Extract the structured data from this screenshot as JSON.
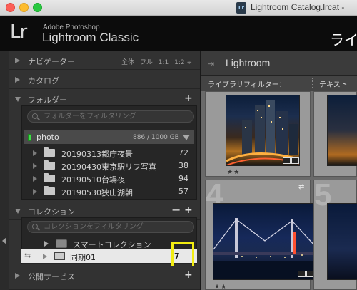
{
  "window": {
    "title": "Lightroom Catalog.lrcat - ",
    "doc_icon_text": "Lr"
  },
  "identity": {
    "logo": "Lr",
    "line1": "Adobe Photoshop",
    "line2": "Lightroom Classic",
    "module_partial": "ライ"
  },
  "navigator": {
    "title": "ナビゲーター",
    "options": [
      "全体",
      "フル",
      "1:1",
      "1:2 ÷"
    ]
  },
  "catalog": {
    "title": "カタログ"
  },
  "folders": {
    "title": "フォルダー",
    "filter_placeholder": "フォルダーをフィルタリング",
    "volume": {
      "name": "photo",
      "size": "886 / 1000 GB"
    },
    "items": [
      {
        "name": "20190313都庁夜景",
        "count": "72"
      },
      {
        "name": "20190430東京駅リフ写真",
        "count": "38"
      },
      {
        "name": "20190510台場夜",
        "count": "94"
      },
      {
        "name": "20190530狭山湖朝",
        "count": "57"
      }
    ]
  },
  "collections": {
    "title": "コレクション",
    "filter_placeholder": "コレクションをフィルタリング",
    "smart_collections": "スマートコレクション",
    "sync": {
      "name": "同期01",
      "count": "7"
    }
  },
  "publish": {
    "title": "公開サービス"
  },
  "center": {
    "title": "Lightroom",
    "filter_label": "ライブラリフィルター：",
    "filter_text": "テキスト"
  },
  "grid": {
    "cells": [
      {
        "number": "",
        "rating": "★★"
      },
      {
        "number": "4",
        "rating": "★★"
      },
      {
        "number": "5",
        "rating": ""
      }
    ]
  },
  "colors": {
    "highlight": "#f2ec11",
    "volume_led": "#3ee045",
    "panel_bg": "#323232",
    "selected_row": "#e8e8e8"
  }
}
